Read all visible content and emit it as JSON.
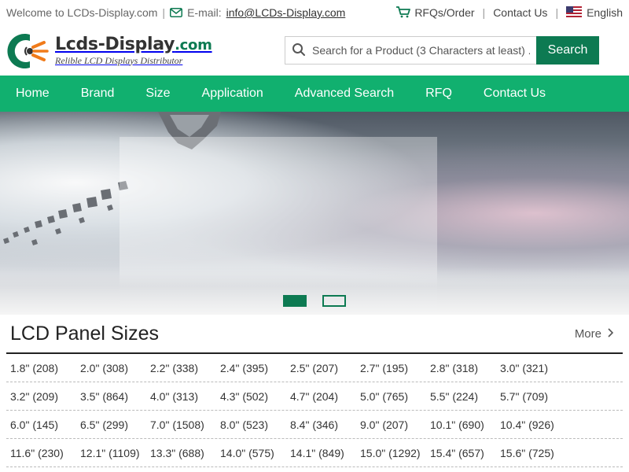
{
  "topbar": {
    "welcome": "Welcome to LCDs-Display.com",
    "separator": "|",
    "email_label": "E-mail:",
    "email": "info@LCDs-Display.com",
    "rfq_label": "RFQs/Order",
    "contact_label": "Contact Us",
    "language": "English"
  },
  "header": {
    "logo_name": "Lcds-Display",
    "logo_suffix": ".com",
    "logo_tagline": "Relible LCD Displays Distributor",
    "search_placeholder": "Search for a Product (3 Characters at least) ...",
    "search_button": "Search"
  },
  "nav": [
    "Home",
    "Brand",
    "Size",
    "Application",
    "Advanced Search",
    "RFQ",
    "Contact Us"
  ],
  "banner": {
    "slide_count": 2,
    "active_slide": 1
  },
  "sizes": {
    "title": "LCD Panel Sizes",
    "more_label": "More",
    "rows": [
      [
        "1.8\" (208)",
        "2.0\" (308)",
        "2.2\" (338)",
        "2.4\" (395)",
        "2.5\" (207)",
        "2.7\" (195)",
        "2.8\" (318)",
        "3.0\" (321)"
      ],
      [
        "3.2\" (209)",
        "3.5\" (864)",
        "4.0\" (313)",
        "4.3\" (502)",
        "4.7\" (204)",
        "5.0\" (765)",
        "5.5\" (224)",
        "5.7\" (709)"
      ],
      [
        "6.0\" (145)",
        "6.5\" (299)",
        "7.0\" (1508)",
        "8.0\" (523)",
        "8.4\" (346)",
        "9.0\" (207)",
        "10.1\" (690)",
        "10.4\" (926)"
      ],
      [
        "11.6\" (230)",
        "12.1\" (1109)",
        "13.3\" (688)",
        "14.0\" (575)",
        "14.1\" (849)",
        "15.0\" (1292)",
        "15.4\" (657)",
        "15.6\" (725)"
      ]
    ]
  },
  "colors": {
    "brand_green": "#11b06f",
    "dark_green": "#0d7a52",
    "logo_orange": "#f07b1a"
  },
  "icons": {
    "mail": "envelope-icon",
    "cart": "cart-icon",
    "flag": "us-flag-icon",
    "search": "search-icon",
    "more": "chevron-right-icon"
  }
}
